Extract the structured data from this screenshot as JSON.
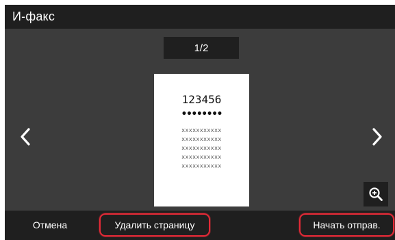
{
  "header": {
    "title": "И-факс"
  },
  "preview": {
    "page_counter": "1/2",
    "document": {
      "number": "123456",
      "masked": "••••••••",
      "lines": [
        "xxxxxxxxxxx",
        "xxxxxxxxxxx",
        "xxxxxxxxxxx",
        "xxxxxxxxxxx",
        "xxxxxxxxxxx"
      ]
    },
    "icons": {
      "prev": "chevron-left-icon",
      "next": "chevron-right-icon",
      "zoom": "zoom-in-icon"
    }
  },
  "footer": {
    "cancel_label": "Отмена",
    "delete_label": "Удалить страницу",
    "send_label": "Начать отправ."
  },
  "colors": {
    "titlebar_bg": "#1f1f1f",
    "preview_bg": "#3c3c3c",
    "highlight": "#e52a37"
  }
}
